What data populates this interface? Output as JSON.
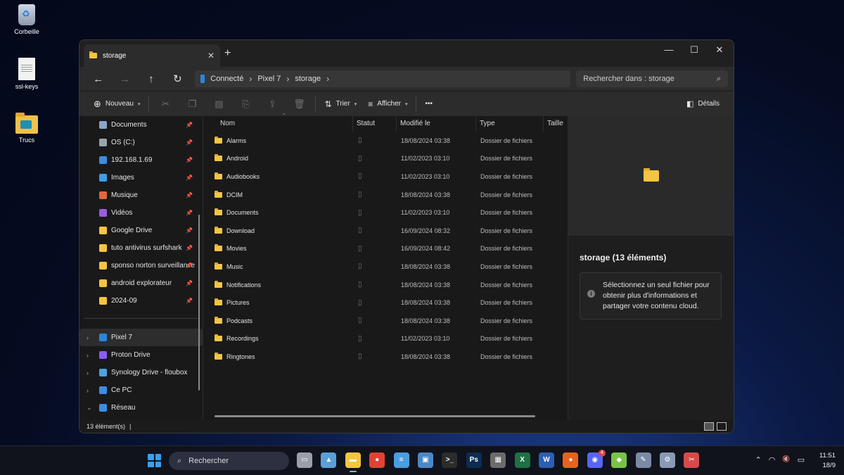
{
  "desktop": {
    "icons": [
      {
        "label": "Corbeille"
      },
      {
        "label": "ssl-keys"
      },
      {
        "label": "Trucs"
      }
    ]
  },
  "window": {
    "tab_title": "storage",
    "tab_close": "✕",
    "new_tab": "+",
    "controls": {
      "minimize": "—",
      "maximize": "☐",
      "close": "✕"
    },
    "nav": {
      "back": "←",
      "forward": "→",
      "up": "↑",
      "refresh": "↻"
    },
    "breadcrumb": [
      "Connecté",
      "Pixel 7",
      "storage"
    ],
    "search_placeholder": "Rechercher dans : storage",
    "toolbar": {
      "new_label": "Nouveau",
      "sort_label": "Trier",
      "view_label": "Afficher",
      "more_label": "•••",
      "details_label": "Détails"
    },
    "sidebar": {
      "pinned": [
        {
          "label": "Documents",
          "color": "#8aa6c9"
        },
        {
          "label": "OS (C:)",
          "color": "#9aa3ad"
        },
        {
          "label": "192.168.1.69",
          "color": "#3c8de0"
        },
        {
          "label": "Images",
          "color": "#3b9ee8"
        },
        {
          "label": "Musique",
          "color": "#e0673e"
        },
        {
          "label": "Vidéos",
          "color": "#9a5be0"
        },
        {
          "label": "Google Drive",
          "color": "#f4c542"
        },
        {
          "label": "tuto antivirus surfshark",
          "color": "#f4c542"
        },
        {
          "label": "sponso norton surveillance",
          "color": "#f4c542"
        },
        {
          "label": "android explorateur",
          "color": "#f4c542"
        },
        {
          "label": "2024-09",
          "color": "#f4c542"
        }
      ],
      "locations": [
        {
          "label": "Pixel 7",
          "color": "#2b86de",
          "expand": "›",
          "selected": true
        },
        {
          "label": "Proton Drive",
          "color": "#8b5cf6",
          "expand": "›"
        },
        {
          "label": "Synology Drive - floubox",
          "color": "#4aa3e0",
          "expand": "›"
        },
        {
          "label": "Ce PC",
          "color": "#3c8de0",
          "expand": "›"
        },
        {
          "label": "Réseau",
          "color": "#3c8de0",
          "expand": "⌄"
        }
      ]
    },
    "columns": {
      "name": "Nom",
      "status": "Statut",
      "modified": "Modifié le",
      "type": "Type",
      "size": "Taille"
    },
    "files": [
      {
        "name": "Alarms",
        "status": "▯",
        "modified": "18/08/2024 03:38",
        "type": "Dossier de fichiers"
      },
      {
        "name": "Android",
        "status": "▯",
        "modified": "11/02/2023 03:10",
        "type": "Dossier de fichiers"
      },
      {
        "name": "Audiobooks",
        "status": "▯",
        "modified": "11/02/2023 03:10",
        "type": "Dossier de fichiers"
      },
      {
        "name": "DCIM",
        "status": "▯",
        "modified": "18/08/2024 03:38",
        "type": "Dossier de fichiers"
      },
      {
        "name": "Documents",
        "status": "▯",
        "modified": "11/02/2023 03:10",
        "type": "Dossier de fichiers"
      },
      {
        "name": "Download",
        "status": "▯",
        "modified": "16/09/2024 08:32",
        "type": "Dossier de fichiers"
      },
      {
        "name": "Movies",
        "status": "▯",
        "modified": "16/09/2024 08:42",
        "type": "Dossier de fichiers"
      },
      {
        "name": "Music",
        "status": "▯",
        "modified": "18/08/2024 03:38",
        "type": "Dossier de fichiers"
      },
      {
        "name": "Notifications",
        "status": "▯",
        "modified": "18/08/2024 03:38",
        "type": "Dossier de fichiers"
      },
      {
        "name": "Pictures",
        "status": "▯",
        "modified": "18/08/2024 03:38",
        "type": "Dossier de fichiers"
      },
      {
        "name": "Podcasts",
        "status": "▯",
        "modified": "18/08/2024 03:38",
        "type": "Dossier de fichiers"
      },
      {
        "name": "Recordings",
        "status": "▯",
        "modified": "11/02/2023 03:10",
        "type": "Dossier de fichiers"
      },
      {
        "name": "Ringtones",
        "status": "▯",
        "modified": "18/08/2024 03:38",
        "type": "Dossier de fichiers"
      }
    ],
    "details": {
      "title": "storage (13 éléments)",
      "info_text": "Sélectionnez un seul fichier pour obtenir plus d'informations et partager votre contenu cloud."
    },
    "status_bar": {
      "count": "13 élément(s)",
      "separator": "|"
    }
  },
  "taskbar": {
    "search_placeholder": "Rechercher",
    "apps": [
      {
        "name": "task-view",
        "color": "#9aa0aa",
        "glyph": "▭"
      },
      {
        "name": "photos",
        "color": "#5aa0d8",
        "glyph": "▲"
      },
      {
        "name": "file-explorer",
        "color": "#f4c542",
        "glyph": "▬",
        "active": true
      },
      {
        "name": "chrome",
        "color": "#e34133",
        "glyph": "●"
      },
      {
        "name": "notepad",
        "color": "#4a9de0",
        "glyph": "≡"
      },
      {
        "name": "remote-desktop",
        "color": "#4a88c8",
        "glyph": "▣"
      },
      {
        "name": "terminal",
        "color": "#2c2c2c",
        "glyph": ">_"
      },
      {
        "name": "photoshop",
        "color": "#0c2d52",
        "glyph": "Ps"
      },
      {
        "name": "calculator",
        "color": "#6b6b6b",
        "glyph": "▦"
      },
      {
        "name": "excel",
        "color": "#1d7144",
        "glyph": "X"
      },
      {
        "name": "word",
        "color": "#2b5fb4",
        "glyph": "W"
      },
      {
        "name": "firefox",
        "color": "#e8611e",
        "glyph": "●"
      },
      {
        "name": "discord",
        "color": "#5865f2",
        "glyph": "◉",
        "badge": "4"
      },
      {
        "name": "color-app",
        "color": "#7ac24a",
        "glyph": "◆"
      },
      {
        "name": "tool-app",
        "color": "#7a8aa5",
        "glyph": "✎"
      },
      {
        "name": "settings",
        "color": "#8a9ab5",
        "glyph": "⚙"
      },
      {
        "name": "snipping-tool",
        "color": "#d64a4a",
        "glyph": "✂"
      }
    ],
    "tray": {
      "chevron": "⌃",
      "wifi": "◠",
      "volume": "🔇",
      "battery": "▭"
    },
    "time": "11:51",
    "date": "18/9"
  }
}
